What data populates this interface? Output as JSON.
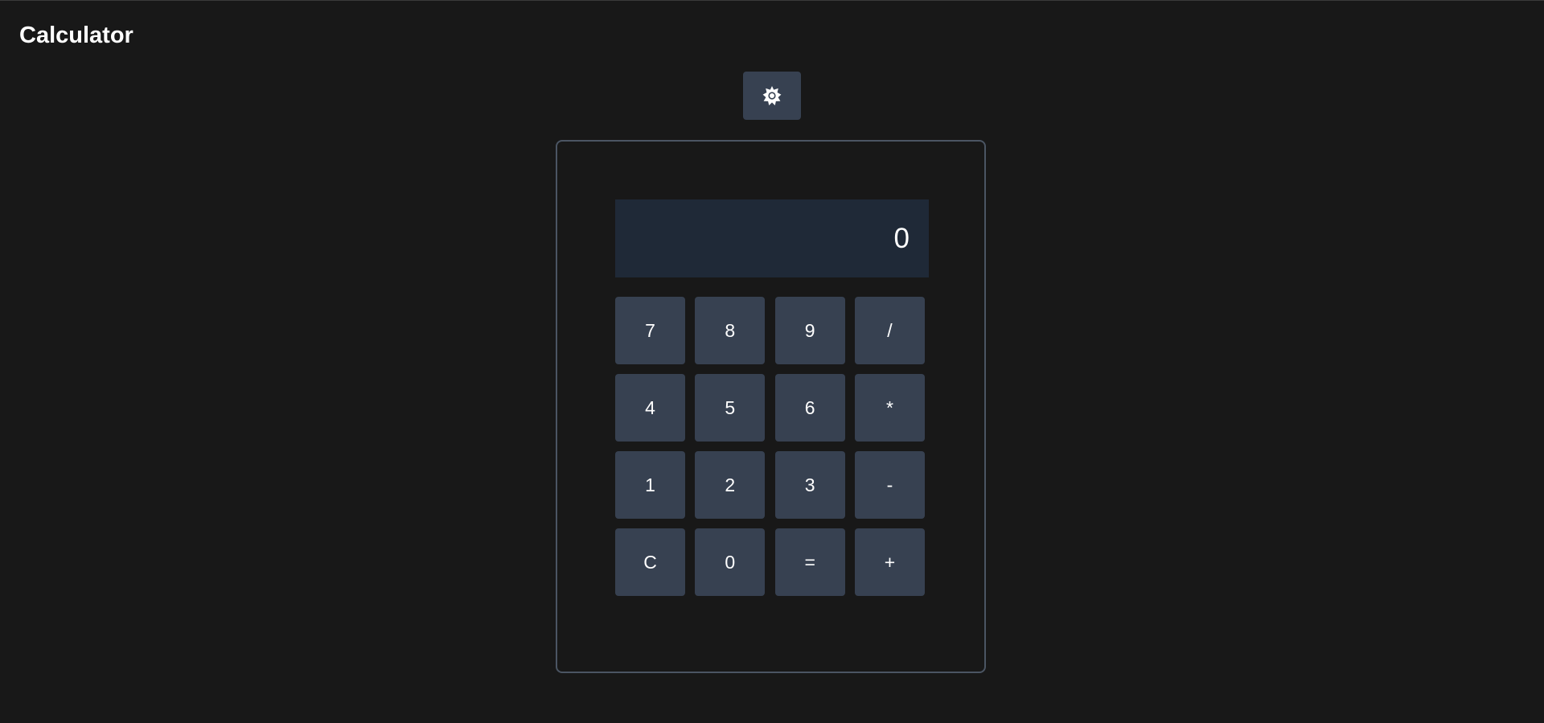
{
  "app": {
    "title": "Calculator"
  },
  "theme_toggle": {
    "icon": "sun-icon"
  },
  "display": {
    "value": "0"
  },
  "keypad": {
    "keys": [
      {
        "label": "7",
        "name": "key-7"
      },
      {
        "label": "8",
        "name": "key-8"
      },
      {
        "label": "9",
        "name": "key-9"
      },
      {
        "label": "/",
        "name": "key-divide"
      },
      {
        "label": "4",
        "name": "key-4"
      },
      {
        "label": "5",
        "name": "key-5"
      },
      {
        "label": "6",
        "name": "key-6"
      },
      {
        "label": "*",
        "name": "key-multiply"
      },
      {
        "label": "1",
        "name": "key-1"
      },
      {
        "label": "2",
        "name": "key-2"
      },
      {
        "label": "3",
        "name": "key-3"
      },
      {
        "label": "-",
        "name": "key-subtract"
      },
      {
        "label": "C",
        "name": "key-clear"
      },
      {
        "label": "0",
        "name": "key-0"
      },
      {
        "label": "=",
        "name": "key-equals"
      },
      {
        "label": "+",
        "name": "key-add"
      }
    ]
  },
  "colors": {
    "background": "#181818",
    "button": "#374151",
    "display_bg": "#1f2937",
    "panel_border": "#4b5563",
    "text": "#ffffff"
  }
}
